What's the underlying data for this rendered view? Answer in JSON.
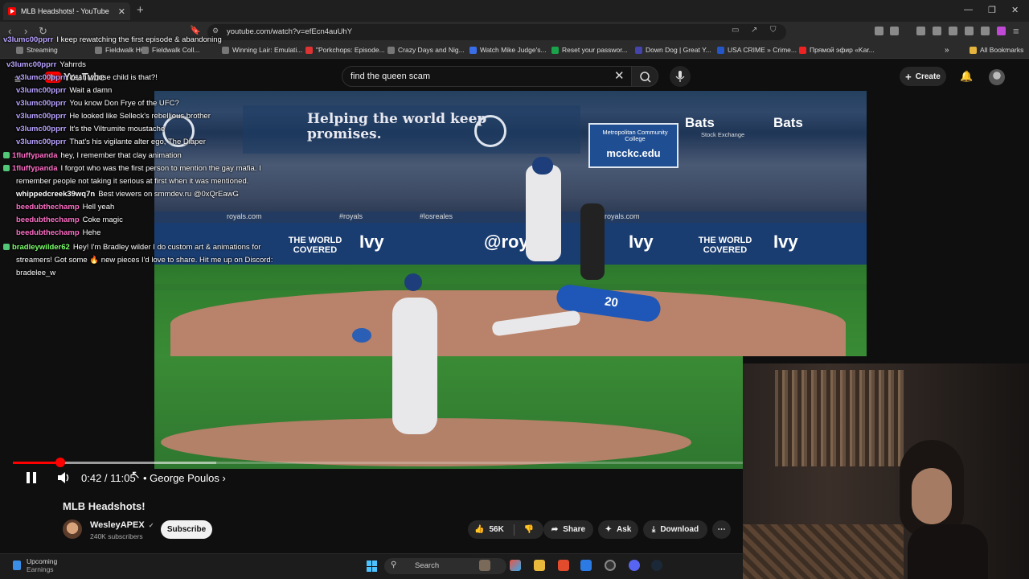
{
  "browser": {
    "tab_title": "MLB Headshots! - YouTube",
    "url": "youtube.com/watch?v=efEcn4auUhY",
    "bookmarks": [
      "Streaming",
      "Fieldwalk HQ",
      "Fieldwalk Coll...",
      "Winning Lair: Emulati...",
      "\"Porkchops: Episode...",
      "Crazy Days and Nig...",
      "Watch Mike Judge's...",
      "Reset your passwor...",
      "Down Dog | Great Y...",
      "USA CRIME » Crime...",
      "Прямой эфир «Kar...",
      "All Bookmarks"
    ]
  },
  "youtube": {
    "logo_text": "YouTube",
    "search_value": "find the queen scam",
    "create_label": "Create"
  },
  "chat": [
    {
      "user": "v3lumc00pprr",
      "msg": "I keep rewatching the first episode & abandoning",
      "color": "u-purple"
    },
    {
      "user": "v3lumc00pprr",
      "msg": "Yahrrds",
      "color": "u-purple"
    },
    {
      "user": "v3lumc00pprr",
      "msg": "Yeah whose child is that?!",
      "color": "u-purple"
    },
    {
      "user": "v3lumc00pprr",
      "msg": "Wait a damn",
      "color": "u-purple"
    },
    {
      "user": "v3lumc00pprr",
      "msg": "You know Don Frye of the UFC?",
      "color": "u-purple"
    },
    {
      "user": "v3lumc00pprr",
      "msg": "He looked like Selleck's rebellious brother",
      "color": "u-purple"
    },
    {
      "user": "v3lumc00pprr",
      "msg": "It's the Viltrumite moustache",
      "color": "u-purple"
    },
    {
      "user": "v3lumc00pprr",
      "msg": "That's his vigilante alter ego, The Diaper",
      "color": "u-purple"
    },
    {
      "user": "1fluffypanda",
      "msg": "hey, I remember that clay animation",
      "color": "u-pink"
    },
    {
      "user": "1fluffypanda",
      "msg": "I forgot who was the first person to mention the gay mafia. I",
      "color": "u-pink"
    },
    {
      "user": "",
      "msg": "remember people not taking it serious at first when it was mentioned.",
      "color": "u-pink"
    },
    {
      "user": "whippedcreek39wq7n",
      "msg": "Best viewers on smmdev.ru @0xQrEawG",
      "color": "u-white"
    },
    {
      "user": "beedubthechamp",
      "msg": "Hell yeah",
      "color": "u-pink"
    },
    {
      "user": "beedubthechamp",
      "msg": "Coke magic",
      "color": "u-pink"
    },
    {
      "user": "beedubthechamp",
      "msg": "Hehe",
      "color": "u-pink"
    },
    {
      "user": "bradleywilder62",
      "msg": "Hey! I'm Bradley wilder I do custom art & animations for",
      "color": "u-green"
    },
    {
      "user": "",
      "msg": "streamers! Got some 🔥 new pieces I'd love to share. Hit me up on Discord:",
      "color": "u-green"
    },
    {
      "user": "",
      "msg": "bradelee_w",
      "color": "u-green"
    }
  ],
  "video": {
    "ad_left": "Helping the world keep promises.",
    "mcc_label": "mcckc.edu",
    "mcc_top": "Metropolitan Community College",
    "bats_1": "Bats",
    "bats_2": "Bats",
    "bats_sub": "Stock Exchange",
    "wall_left": "royals.com",
    "wall_mid1": "#royals",
    "wall_mid2": "#losreales",
    "wall_right": "royals.com",
    "panel_world": "THE WORLD COVERED",
    "panel_ivy": "Ivy",
    "panel_royals": "@roya",
    "jersey": "20",
    "progress_fraction": 0.0645
  },
  "player": {
    "time": "0:42 / 11:05",
    "chapter": "• George Poulos",
    "chapter_arrow": "›"
  },
  "below": {
    "title": "MLB Headshots!",
    "channel": "WesleyAPEX",
    "verified": "✓",
    "subscribers": "240K subscribers",
    "subscribe_label": "Subscribe",
    "likes": "56K",
    "share_label": "Share",
    "ask_label": "Ask",
    "download_label": "Download",
    "more_label": "⋯"
  },
  "taskbar": {
    "weather_1": "Upcoming",
    "weather_2": "Earnings",
    "search_placeholder": "Search"
  }
}
